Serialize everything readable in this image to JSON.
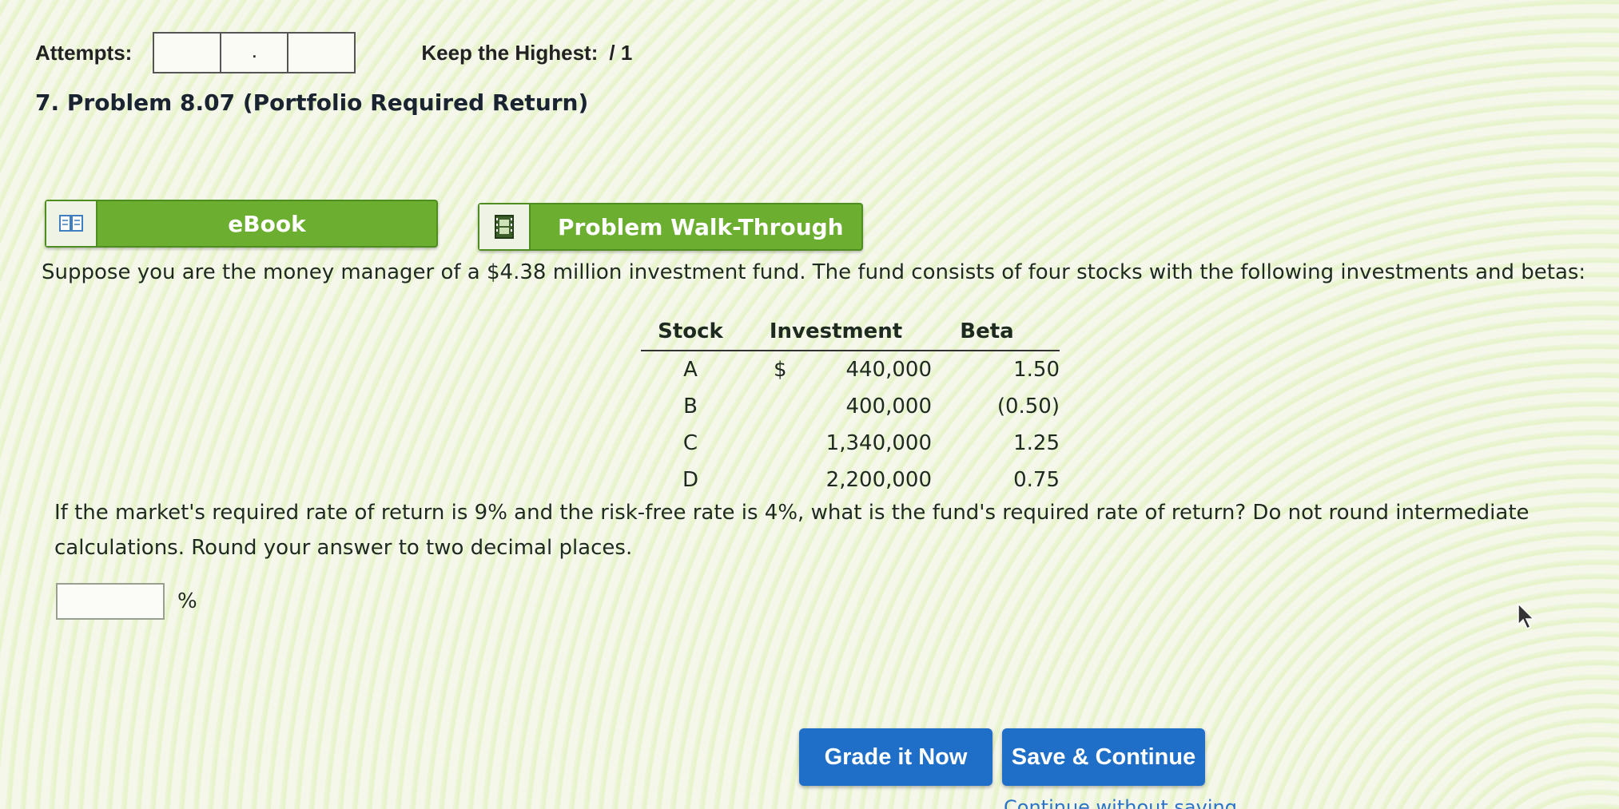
{
  "attempts": {
    "label": "Attempts:",
    "box_separator": ".",
    "keep_highest_label": "Keep the Highest:",
    "keep_highest_value": "/ 1"
  },
  "problem": {
    "title": "7. Problem 8.07 (Portfolio Required Return)"
  },
  "resources": {
    "ebook_label": "eBook",
    "walkthrough_label": "Problem Walk-Through",
    "ebook_icon": "book-icon",
    "walkthrough_icon": "film-icon"
  },
  "intro_text": "Suppose you are the money manager of a $4.38 million investment fund. The fund consists of four stocks with the following investments and betas:",
  "table": {
    "headers": [
      "Stock",
      "Investment",
      "Beta"
    ],
    "dollar_sign": "$",
    "rows": [
      {
        "stock": "A",
        "investment": "440,000",
        "beta": "1.50"
      },
      {
        "stock": "B",
        "investment": "400,000",
        "beta": "(0.50)"
      },
      {
        "stock": "C",
        "investment": "1,340,000",
        "beta": "1.25"
      },
      {
        "stock": "D",
        "investment": "2,200,000",
        "beta": "0.75"
      }
    ]
  },
  "question_text": "If the market's required rate of return is 9% and the risk-free rate is 4%, what is the fund's required rate of return? Do not round intermediate calculations. Round your answer to two decimal places.",
  "answer": {
    "value": "",
    "unit": "%"
  },
  "buttons": {
    "grade_label": "Grade it Now",
    "save_label": "Save & Continue",
    "continue_label": "Continue without saving"
  },
  "colors": {
    "green_button": "#6cae2f",
    "blue_button": "#1f6fc9"
  }
}
